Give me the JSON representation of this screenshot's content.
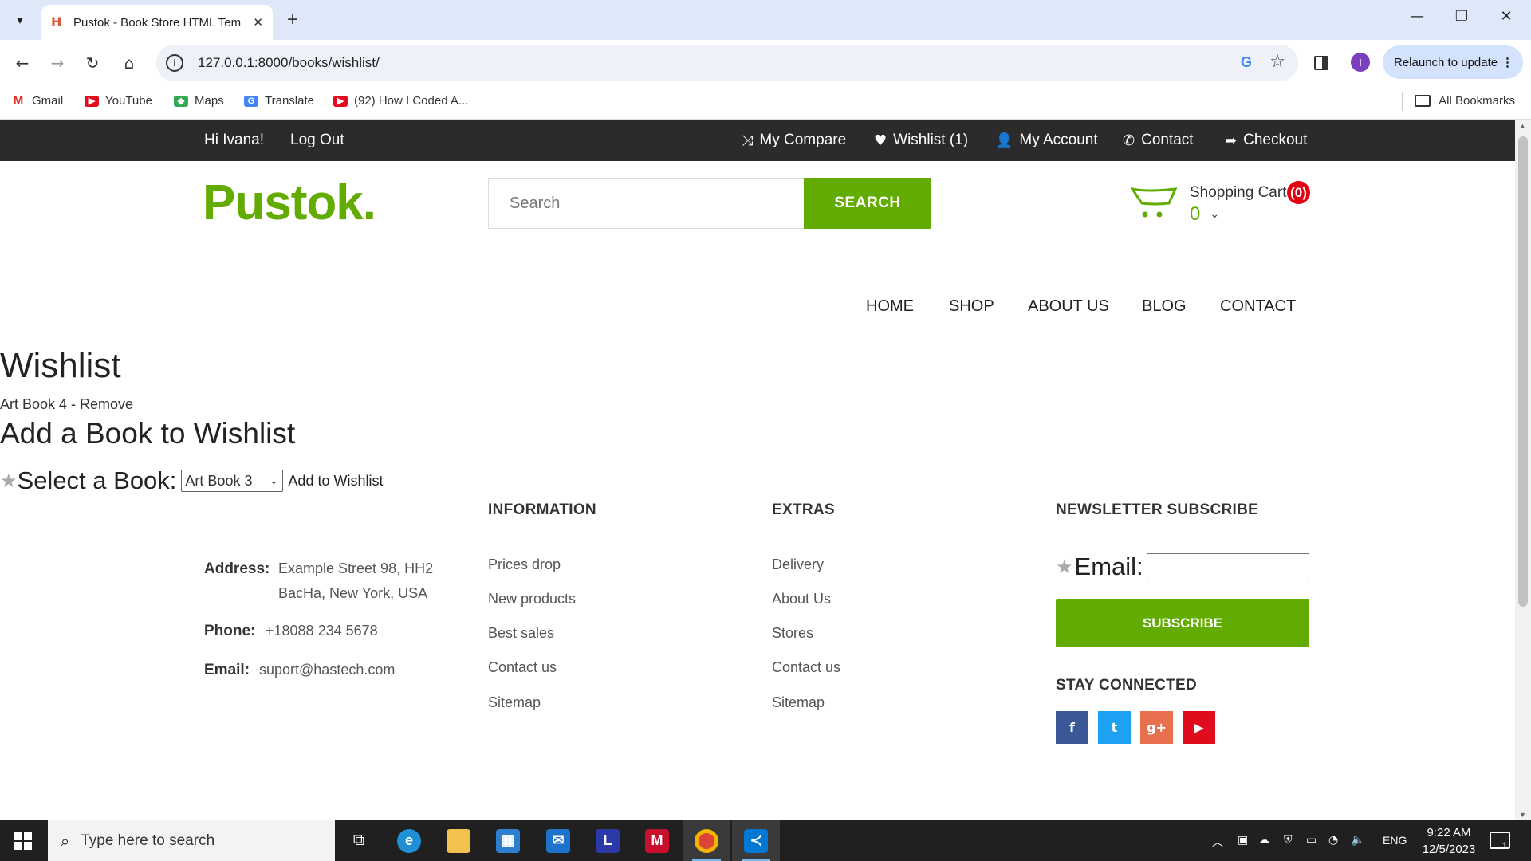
{
  "browser": {
    "tab_title": "Pustok - Book Store HTML Tem",
    "url": "127.0.0.1:8000/books/wishlist/",
    "profile_initial": "I",
    "relaunch_label": "Relaunch to update",
    "bookmarks": [
      "Gmail",
      "YouTube",
      "Maps",
      "Translate",
      "(92) How I Coded A..."
    ],
    "all_bookmarks": "All Bookmarks"
  },
  "topbar": {
    "greeting": "Hi Ivana!",
    "logout": "Log Out",
    "compare": "My Compare",
    "wishlist": "Wishlist (1)",
    "account": "My Account",
    "contact": "Contact",
    "checkout": "Checkout"
  },
  "header": {
    "logo": "Pustok.",
    "search_placeholder": "Search",
    "search_button": "SEARCH",
    "cart_label": "Shopping Cart",
    "cart_count": "(0)",
    "cart_total": "0"
  },
  "nav": [
    "HOME",
    "SHOP",
    "ABOUT US",
    "BLOG",
    "CONTACT"
  ],
  "wishlist": {
    "title": "Wishlist",
    "item": "Art Book 4 - Remove",
    "add_title": "Add a Book to Wishlist",
    "select_label": "Select a Book:",
    "selected_book": "Art Book 3",
    "add_button": "Add to Wishlist"
  },
  "footer": {
    "contact": {
      "address_label": "Address:",
      "address_line1": "Example Street 98, HH2",
      "address_line2": "BacHa, New York, USA",
      "phone_label": "Phone:",
      "phone": "+18088 234 5678",
      "email_label": "Email:",
      "email": "suport@hastech.com"
    },
    "information": {
      "heading": "INFORMATION",
      "links": [
        "Prices drop",
        "New products",
        "Best sales",
        "Contact us",
        "Sitemap"
      ]
    },
    "extras": {
      "heading": "EXTRAS",
      "links": [
        "Delivery",
        "About Us",
        "Stores",
        "Contact us",
        "Sitemap"
      ]
    },
    "newsletter": {
      "heading": "NEWSLETTER SUBSCRIBE",
      "email_label": "Email:",
      "subscribe_button": "SUBSCRIBE",
      "stay_connected": "STAY CONNECTED",
      "socials": [
        {
          "name": "facebook",
          "glyph": "f",
          "color": "#3b5998"
        },
        {
          "name": "twitter",
          "glyph": "t",
          "color": "#1da1f2"
        },
        {
          "name": "google-plus",
          "glyph": "g+",
          "color": "#e9704f"
        },
        {
          "name": "youtube",
          "glyph": "▶",
          "color": "#e00b1c"
        }
      ]
    }
  },
  "taskbar": {
    "search_placeholder": "Type here to search",
    "language": "ENG",
    "time": "9:22 AM",
    "date": "12/5/2023",
    "notification_count": "1"
  },
  "colors": {
    "brand_green": "#62ab00",
    "topbar_bg": "#2b2b2b",
    "cart_badge": "#e30012"
  }
}
